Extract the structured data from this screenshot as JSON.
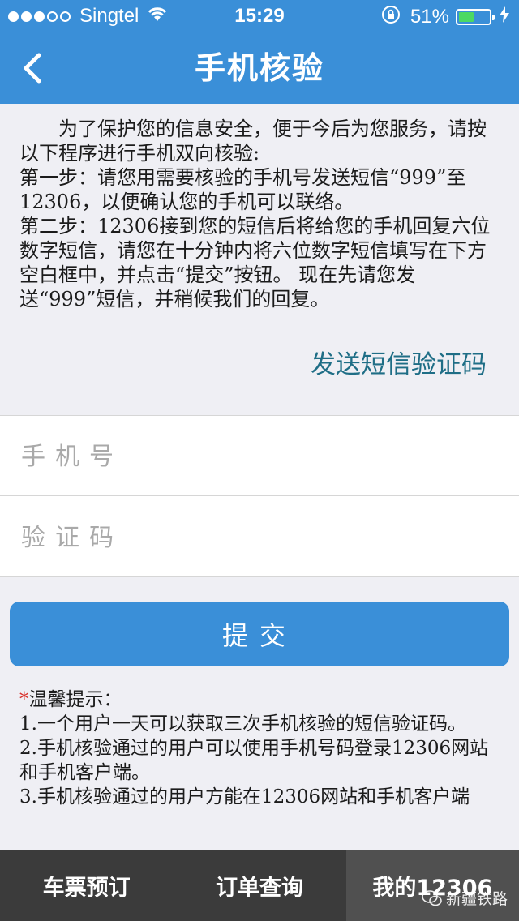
{
  "status_bar": {
    "carrier": "Singtel",
    "time": "15:29",
    "battery": "51%",
    "battery_level": 0.51,
    "signal_strength": 3,
    "icons": [
      "wifi-icon",
      "lock-rotation-icon",
      "battery-icon",
      "charging-icon"
    ]
  },
  "nav": {
    "title": "手机核验",
    "back_icon": "chevron-left-icon"
  },
  "instructions": {
    "line1": "为了保护您的信息安全，便于今后为您服务，请按以下程序进行手机双向核验:",
    "step1": "第一步：请您用需要核验的手机号发送短信“999”至12306，以便确认您的手机可以联络。",
    "step2": "第二步：12306接到您的短信后将给您的手机回复六位数字短信，请您在十分钟内将六位数字短信填写在下方空白框中，并点击“提交”按钮。 现在先请您发送“999”短信，并稍候我们的回复。"
  },
  "send_sms_label": "发送短信验证码",
  "form": {
    "phone_placeholder": "手机号",
    "phone_value": "",
    "code_placeholder": "验证码",
    "code_value": ""
  },
  "submit_label": "提交",
  "tips": {
    "star": "*",
    "title": "温馨提示：",
    "item1": "1.一个用户一天可以获取三次手机核验的短信验证码。",
    "item2": "2.手机核验通过的用户可以使用手机号码登录12306网站和手机客户端。",
    "item3": "3.手机核验通过的用户方能在12306网站和手机客户端"
  },
  "tabs": [
    {
      "label": "车票预订",
      "active": false
    },
    {
      "label": "订单查询",
      "active": false
    },
    {
      "label": "我的12306",
      "active": true
    }
  ],
  "watermark": "新疆铁路",
  "colors": {
    "accent": "#3a8fd8",
    "link": "#1f6e86",
    "tab_bar": "#3b3b3b",
    "required_star": "#d9302a"
  }
}
